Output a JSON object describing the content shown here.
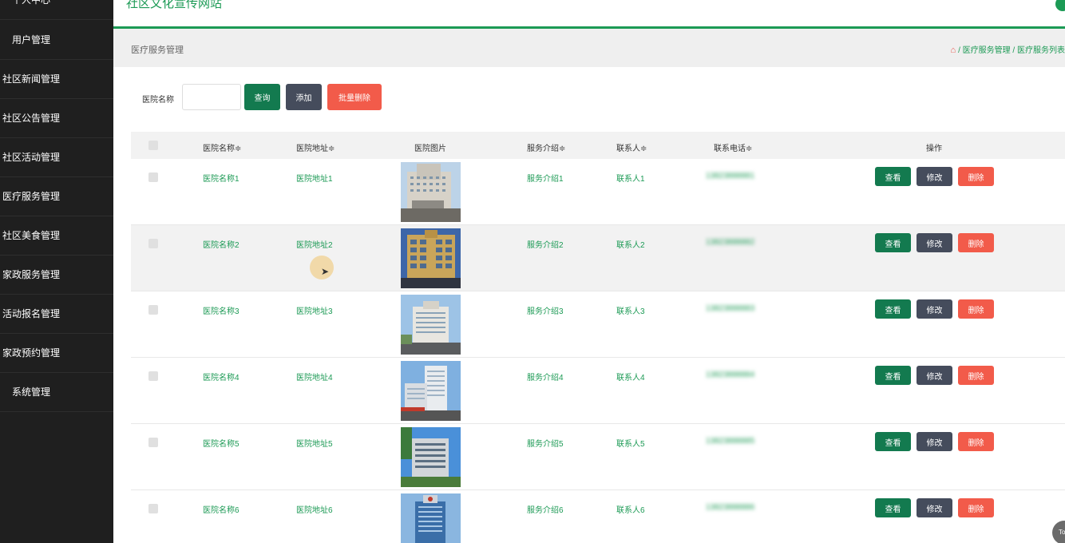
{
  "header": {
    "site_title": "社区文化宣传网站"
  },
  "sidebar": {
    "items": [
      {
        "label": "个人中心",
        "style": "indent"
      },
      {
        "label": "用户管理",
        "style": "indent"
      },
      {
        "label": "社区新闻管理",
        "style": "flush"
      },
      {
        "label": "社区公告管理",
        "style": "flush"
      },
      {
        "label": "社区活动管理",
        "style": "flush"
      },
      {
        "label": "医疗服务管理",
        "style": "flush"
      },
      {
        "label": "社区美食管理",
        "style": "flush"
      },
      {
        "label": "家政服务管理",
        "style": "flush"
      },
      {
        "label": "活动报名管理",
        "style": "flush"
      },
      {
        "label": "家政预约管理",
        "style": "flush"
      },
      {
        "label": "系统管理",
        "style": "indent"
      }
    ]
  },
  "breadcrumb": {
    "title": "医疗服务管理",
    "path": "/ 医疗服务管理 / 医疗服务列表"
  },
  "search": {
    "label": "医院名称",
    "value": "",
    "query_label": "查询",
    "add_label": "添加",
    "batch_delete_label": "批量删除"
  },
  "table": {
    "headers": {
      "name": "医院名称",
      "address": "医院地址",
      "image": "医院图片",
      "intro": "服务介绍",
      "contact": "联系人",
      "phone": "联系电话",
      "actions": "操作"
    },
    "sort_icon": "≑",
    "rows": [
      {
        "name": "医院名称1",
        "address": "医院地址1",
        "intro": "服务介绍1",
        "contact": "联系人1",
        "phone": "13823888881"
      },
      {
        "name": "医院名称2",
        "address": "医院地址2",
        "intro": "服务介绍2",
        "contact": "联系人2",
        "phone": "13823888882"
      },
      {
        "name": "医院名称3",
        "address": "医院地址3",
        "intro": "服务介绍3",
        "contact": "联系人3",
        "phone": "13823888883"
      },
      {
        "name": "医院名称4",
        "address": "医院地址4",
        "intro": "服务介绍4",
        "contact": "联系人4",
        "phone": "13823888884"
      },
      {
        "name": "医院名称5",
        "address": "医院地址5",
        "intro": "服务介绍5",
        "contact": "联系人5",
        "phone": "13823888885"
      },
      {
        "name": "医院名称6",
        "address": "医院地址6",
        "intro": "服务介绍6",
        "contact": "联系人6",
        "phone": "13823888886"
      }
    ],
    "actions": {
      "view": "查看",
      "edit": "修改",
      "delete": "删除"
    }
  },
  "back_to_top": "To"
}
